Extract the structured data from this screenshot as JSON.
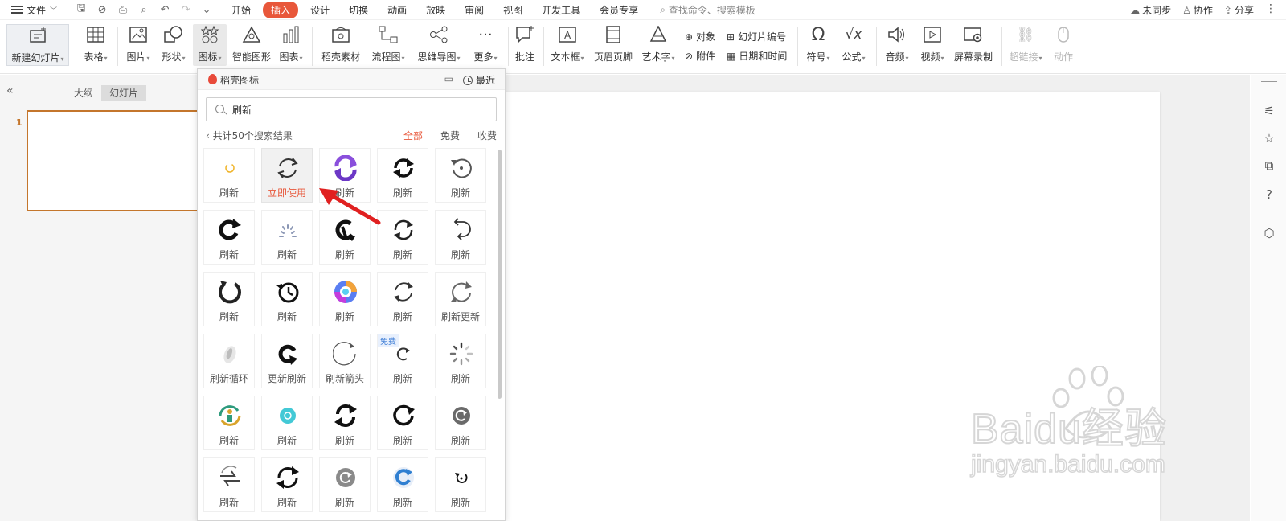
{
  "menubar": {
    "file_label": "文件",
    "tabs": [
      "开始",
      "插入",
      "设计",
      "切换",
      "动画",
      "放映",
      "审阅",
      "视图",
      "开发工具",
      "会员专享"
    ],
    "active_tab": "插入",
    "search_placeholder": "查找命令、搜索模板",
    "sync_label": "未同步",
    "collab_label": "协作",
    "share_label": "分享"
  },
  "ribbon": {
    "new_slide": "新建幻灯片",
    "table": "表格",
    "picture": "图片",
    "shape": "形状",
    "icon": "图标",
    "smart_shape": "智能图形",
    "chart": "图表",
    "daoke_material": "稻壳素材",
    "flowchart": "流程图",
    "mindmap": "思维导图",
    "more": "更多",
    "comment": "批注",
    "textbox": "文本框",
    "header_footer": "页眉页脚",
    "wordart": "艺术字",
    "object": "对象",
    "slide_number": "幻灯片编号",
    "attachment": "附件",
    "datetime": "日期和时间",
    "symbol": "符号",
    "formula": "公式",
    "audio": "音频",
    "video": "视频",
    "screen_record": "屏幕录制",
    "hyperlink": "超链接",
    "action": "动作"
  },
  "left_panel": {
    "outline_tab": "大纲",
    "slides_tab": "幻灯片",
    "slide_number": "1"
  },
  "popup": {
    "title": "稻壳图标",
    "recent_label": "最近",
    "search_value": "刷新",
    "result_count": "共计50个搜索结果",
    "filters": [
      "全部",
      "免费",
      "收费"
    ],
    "active_filter": "全部",
    "free_badge": "免费",
    "icons": [
      {
        "label": "刷新",
        "icon": "loading-ring-yellow-icon"
      },
      {
        "label": "立即使用",
        "icon": "refresh-arrows-thin-icon"
      },
      {
        "label": "刷新",
        "icon": "refresh-purple-icon"
      },
      {
        "label": "刷新",
        "icon": "refresh-bold-icon"
      },
      {
        "label": "刷新",
        "icon": "refresh-ccw-icon"
      },
      {
        "label": "刷新",
        "icon": "redo-bold-icon"
      },
      {
        "label": "刷新",
        "icon": "loading-dashes-icon"
      },
      {
        "label": "刷新",
        "icon": "refresh-half-circle-icon"
      },
      {
        "label": "刷新",
        "icon": "refresh-two-arrows-icon"
      },
      {
        "label": "刷新",
        "icon": "refresh-outline-icon"
      },
      {
        "label": "刷新",
        "icon": "refresh-heavy-ring-icon"
      },
      {
        "label": "刷新",
        "icon": "history-clock-icon"
      },
      {
        "label": "刷新",
        "icon": "refresh-gradient-icon"
      },
      {
        "label": "刷新",
        "icon": "refresh-thin-icon"
      },
      {
        "label": "刷新更新",
        "icon": "refresh-update-icon"
      },
      {
        "label": "刷新循环",
        "icon": "refresh-loop-icon"
      },
      {
        "label": "更新刷新",
        "icon": "update-refresh-icon"
      },
      {
        "label": "刷新箭头",
        "icon": "refresh-arrow-circle-icon"
      },
      {
        "label": "刷新",
        "icon": "refresh-small-icon"
      },
      {
        "label": "刷新",
        "icon": "spinner-icon"
      },
      {
        "label": "刷新",
        "icon": "refresh-person-icon"
      },
      {
        "label": "刷新",
        "icon": "refresh-teal-dot-icon"
      },
      {
        "label": "刷新",
        "icon": "refresh-bold-arrows-icon"
      },
      {
        "label": "刷新",
        "icon": "refresh-ring-icon"
      },
      {
        "label": "刷新",
        "icon": "refresh-grey-dot-icon"
      },
      {
        "label": "刷新",
        "icon": "refresh-double-arrow-icon"
      },
      {
        "label": "刷新",
        "icon": "refresh-two-arrows-heavy-icon"
      },
      {
        "label": "刷新",
        "icon": "refresh-grey-circle-icon"
      },
      {
        "label": "刷新",
        "icon": "refresh-blue-circle-icon"
      },
      {
        "label": "刷新",
        "icon": "refresh-small-black-icon"
      }
    ]
  },
  "watermark": {
    "brand": "Baidu经验",
    "url": "jingyan.baidu.com"
  },
  "colors": {
    "accent": "#e8573a",
    "slide_border": "#c4762c"
  }
}
